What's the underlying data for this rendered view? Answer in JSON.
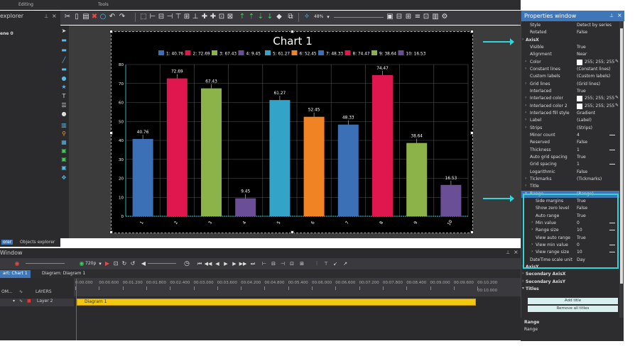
{
  "menu": {
    "editing": "Editing",
    "tools": "Tools"
  },
  "explorer": {
    "title": "explorer",
    "scene_item": "ene 0",
    "tab_active": "orer",
    "tab_objects": "Objects explorer"
  },
  "toolbar": {
    "zoom": "48%"
  },
  "chart_data": {
    "type": "bar",
    "title": "Chart 1",
    "categories": [
      "1",
      "2",
      "3",
      "4",
      "5",
      "6",
      "7",
      "8",
      "9",
      "10"
    ],
    "values": [
      40.76,
      72.69,
      67.43,
      9.45,
      61.27,
      52.45,
      48.33,
      74.47,
      38.64,
      16.53
    ],
    "value_labels": [
      "40.76",
      "72.69",
      "67.43",
      "9.45",
      "61.27",
      "52.45",
      "48.33",
      "74.47",
      "38.64",
      "16.53"
    ],
    "legend": [
      "1: 40.76",
      "2: 72.69",
      "3: 67.43",
      "4: 9.45",
      "5: 61.27",
      "6: 52.45",
      "7: 48.33",
      "8: 74.47",
      "9: 38.64",
      "10: 16.53"
    ],
    "colors": [
      "#3b6fb6",
      "#e0174f",
      "#8cb34a",
      "#6a4f96",
      "#33a3c7",
      "#f08324",
      "#3b6fb6",
      "#e0174f",
      "#8cb34a",
      "#6a4f96"
    ],
    "y_ticks": [
      "0",
      "10",
      "20",
      "30",
      "40",
      "50",
      "60",
      "70",
      "80"
    ],
    "ylim": [
      0,
      80
    ],
    "grid": true,
    "legend_position": "top"
  },
  "timeline": {
    "title": "Window",
    "quality": "720p",
    "tab_scene": "art: Chart 1",
    "tab_diagram": "Diagram: Diagram 1",
    "layers_label": "LAYERS",
    "row_prefix": "OM...",
    "layer_name": "Layer 2",
    "clip_name": "Diagram 1",
    "ruler": [
      "0:00.000",
      "00:00.600",
      "00:01.200",
      "00:01.800",
      "00:02.400",
      "00:03.000",
      "00:03.600",
      "00:04.200",
      "00:04.800",
      "00:05.400",
      "00:06.000",
      "00:06.600",
      "00:07.200",
      "00:07.800",
      "00:08.400",
      "00:09.000",
      "00:09.600",
      "00:10.200"
    ],
    "clip_end": "00:10.000"
  },
  "properties": {
    "title": "Properties window",
    "rows": [
      {
        "name": "Style",
        "value": "Detect by series",
        "kind": "plain"
      },
      {
        "name": "Rotated",
        "value": "False",
        "kind": "plain"
      },
      {
        "name": "AxisX",
        "value": "",
        "kind": "section"
      },
      {
        "name": "Visible",
        "value": "True",
        "kind": "plain"
      },
      {
        "name": "Alignment",
        "value": "Near",
        "kind": "plain"
      },
      {
        "name": "Color",
        "value": "255; 255; 255",
        "kind": "color"
      },
      {
        "name": "Constant lines",
        "value": "(Constant lines)",
        "kind": "expand"
      },
      {
        "name": "Custom labels",
        "value": "(Custom labels)",
        "kind": "plain"
      },
      {
        "name": "Grid lines",
        "value": "(Grid lines)",
        "kind": "expand"
      },
      {
        "name": "Interlaced",
        "value": "True",
        "kind": "plain"
      },
      {
        "name": "Interlaced color",
        "value": "255; 255; 255",
        "kind": "color"
      },
      {
        "name": "Interlaced color 2",
        "value": "255; 255; 255",
        "kind": "color"
      },
      {
        "name": "Interlaced fill style",
        "value": "Gradient",
        "kind": "expand"
      },
      {
        "name": "Label",
        "value": "(Label)",
        "kind": "expand"
      },
      {
        "name": "Strips",
        "value": "(Strips)",
        "kind": "expand"
      },
      {
        "name": "Minor count",
        "value": "4",
        "kind": "slider"
      },
      {
        "name": "Reserved",
        "value": "False",
        "kind": "plain"
      },
      {
        "name": "Thickness",
        "value": "1",
        "kind": "slider"
      },
      {
        "name": "Auto grid spacing",
        "value": "True",
        "kind": "plain"
      },
      {
        "name": "Grid spacing",
        "value": "1",
        "kind": "slider"
      },
      {
        "name": "Logarithmic",
        "value": "False",
        "kind": "plain"
      },
      {
        "name": "Tickmarks",
        "value": "(Tickmarks)",
        "kind": "expand"
      },
      {
        "name": "Title",
        "value": "",
        "kind": "expand"
      },
      {
        "name": "Range",
        "value": "(Range)",
        "kind": "selected"
      },
      {
        "name": "Side margins",
        "value": "True",
        "kind": "indent"
      },
      {
        "name": "Show zero level",
        "value": "False",
        "kind": "indent"
      },
      {
        "name": "Auto range",
        "value": "True",
        "kind": "indent"
      },
      {
        "name": "Min value",
        "value": "0",
        "kind": "indent-slider"
      },
      {
        "name": "Range size",
        "value": "10",
        "kind": "indent-slider"
      },
      {
        "name": "View auto range",
        "value": "True",
        "kind": "indent"
      },
      {
        "name": "View min value",
        "value": "0",
        "kind": "indent-slider"
      },
      {
        "name": "View range size",
        "value": "10",
        "kind": "indent-slider"
      },
      {
        "name": "DateTime scale unit",
        "value": "Day",
        "kind": "plain"
      },
      {
        "name": "AxisY",
        "value": "",
        "kind": "section"
      },
      {
        "name": "Secondary AxisX",
        "value": "",
        "kind": "section"
      },
      {
        "name": "Secondary AxisY",
        "value": "",
        "kind": "section"
      },
      {
        "name": "Titles",
        "value": "",
        "kind": "section-open"
      }
    ],
    "add_title": "Add title",
    "remove_titles": "Remove all titles",
    "desc_title": "Range",
    "desc_text": "Range"
  },
  "accent": "#31d5d8"
}
